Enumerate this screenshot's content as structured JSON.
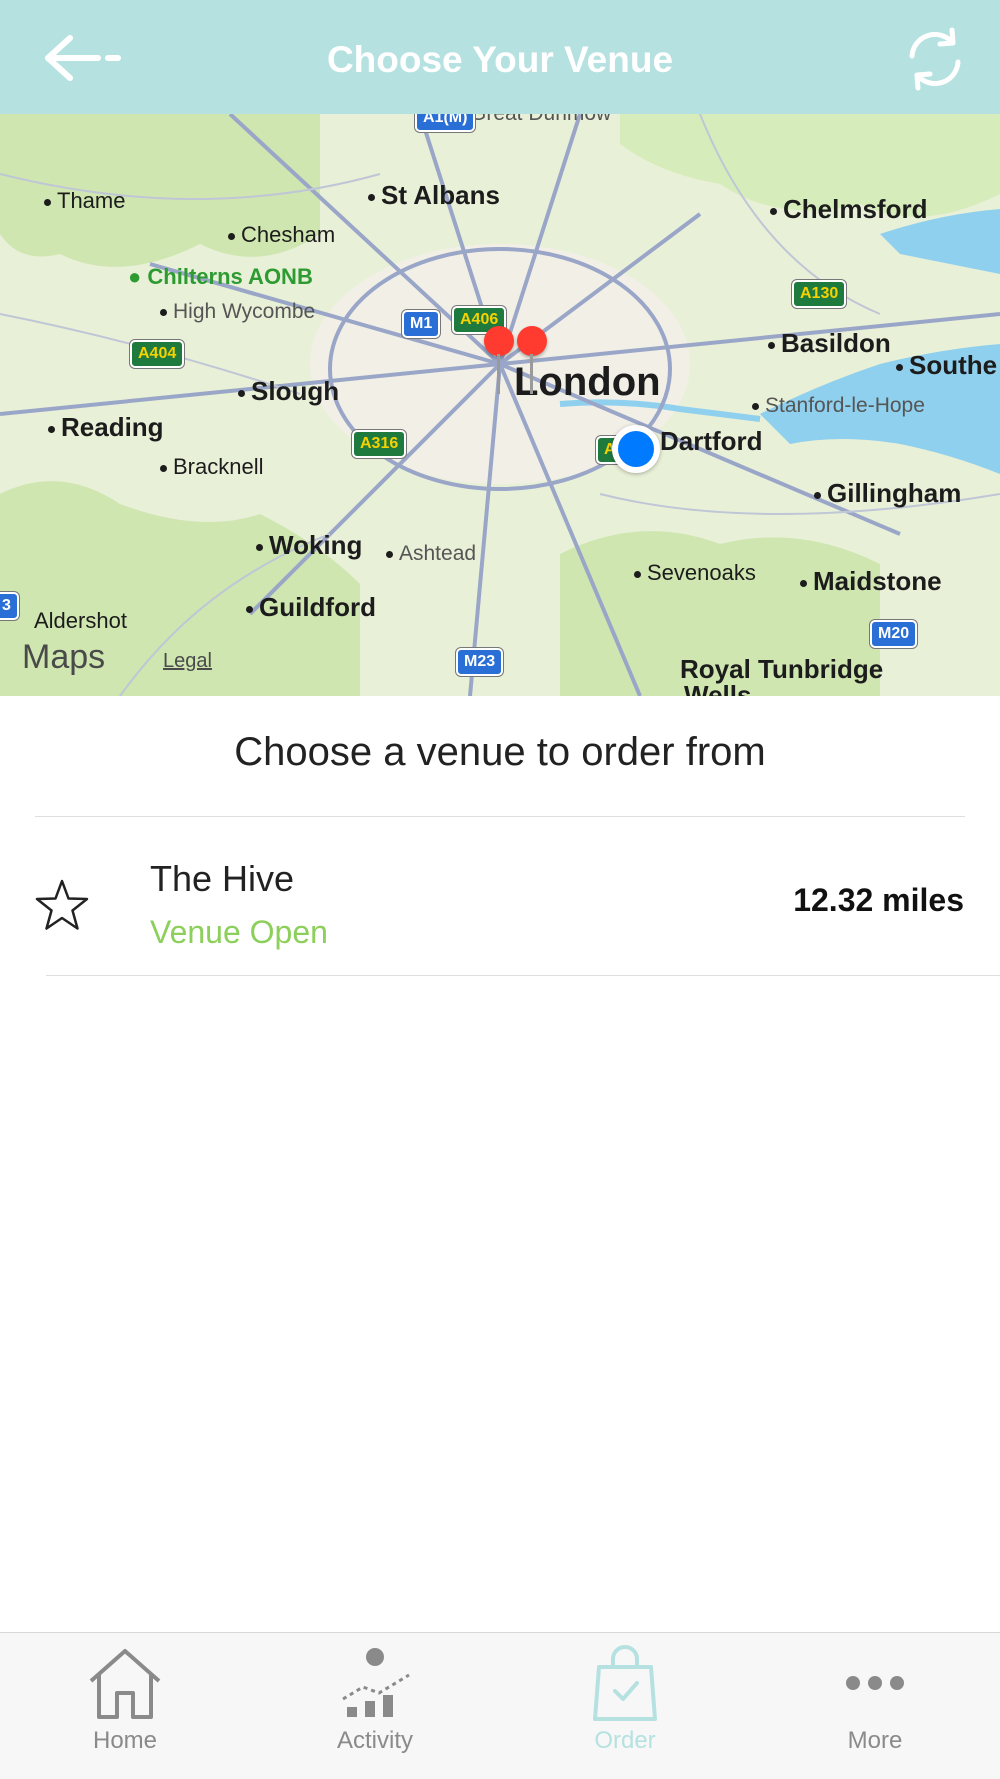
{
  "header": {
    "title": "Choose Your Venue",
    "color": "#b5e2e0"
  },
  "map": {
    "labels": {
      "thame": "Thame",
      "st_albans": "St Albans",
      "chelmsford": "Chelmsford",
      "chesham": "Chesham",
      "chilterns": "Chilterns AONB",
      "high_wycombe": "High Wycombe",
      "basildon": "Basildon",
      "southend": "Southe",
      "london": "London",
      "slough": "Slough",
      "stanford": "Stanford-le-Hope",
      "reading": "Reading",
      "bracknell": "Bracknell",
      "dartford": "Dartford",
      "gillingham": "Gillingham",
      "woking": "Woking",
      "ashtead": "Ashtead",
      "sevenoaks": "Sevenoaks",
      "maidstone": "Maidstone",
      "aldershot": "Aldershot",
      "guildford": "Guildford",
      "royal_tunbridge": "Royal Tunbridge",
      "wells": "Wells",
      "great_dunmow": "Great Dunmow"
    },
    "roads": {
      "a1m": "A1(M)",
      "a406": "A406",
      "m1": "M1",
      "a130": "A130",
      "a404": "A404",
      "a316": "A316",
      "a2": "A",
      "m23": "M23",
      "m20": "M20",
      "m3": "3"
    },
    "attribution": "Maps",
    "legal": "Legal"
  },
  "list": {
    "subtitle": "Choose a venue to order from",
    "venues": [
      {
        "name": "The Hive",
        "status": "Venue Open",
        "distance": "12.32 miles",
        "status_color": "#8ccf5a"
      }
    ]
  },
  "tabbar": {
    "items": [
      {
        "label": "Home",
        "icon": "home-icon"
      },
      {
        "label": "Activity",
        "icon": "activity-icon"
      },
      {
        "label": "Order",
        "icon": "shopping-bag-icon",
        "active": true
      },
      {
        "label": "More",
        "icon": "more-icon"
      }
    ],
    "active_color": "#b5e2e0"
  }
}
